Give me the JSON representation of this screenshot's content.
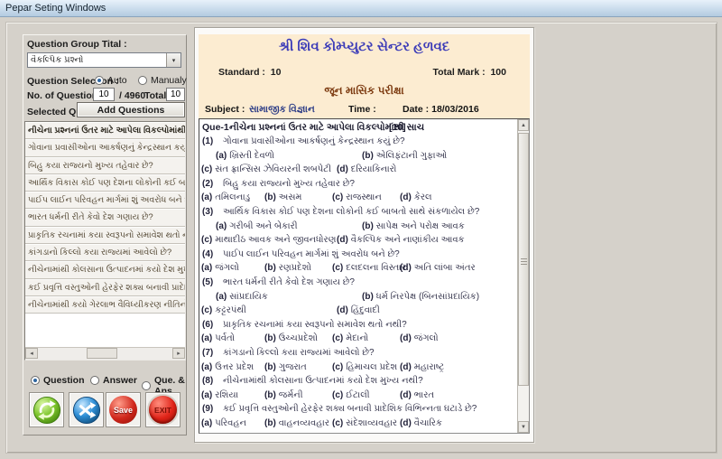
{
  "window": {
    "title": "Pepar Seting Windows"
  },
  "left_panel": {
    "group_title_label": "Question Group Tital :",
    "group_title_value": "વૈકલ્પિક પ્રશ્નો",
    "question_selection_label": "Question Selection :",
    "auto_label": "Auto",
    "manually_label": "Manualy",
    "no_of_questions_label": "No. of Questions :",
    "no_of_questions_value": "10",
    "of_total_label": "/ 4960",
    "total_label": "Total",
    "total_value": "10",
    "selected_questions_label": "Selected Questions :",
    "add_questions_button": "Add Questions",
    "list_rows": [
      "નીચેના પ્રશ્નનાં ઉતર માટે આપેલા વિકલ્પોમાંથી સાચ",
      "ગોવાના પ્રવાસીઓના આકર્ષણનું કેન્દ્રસ્થાન કયું છે?",
      "બિહુ કયા રાજ્યનો મુખ્ય તહેવાર છે?",
      "આર્થિક વિકાસ કોઈ પણ દેશના લોકોની કઈ બાબતો સાથે સં",
      "પાઈપ લાઈન પરિવહન માર્ગમાં શું અવરોધ બને છે?",
      "ભારત ધર્મની રીતે કેવો દેશ ગણાય છે?",
      "પ્રાકૃતિક રચનામાં કયા સ્વરૂપનો સમાવેશ થતો નથી?",
      "કાંગડાનો કિલ્લો કયા રાજ્યમાં આવેલો છે?",
      "નીચેનામાંથી કોલસાના ઉત્પાદનમાં કયો દેશ મુખ્ય નથી?",
      "કઈ પ્રવૃત્તિ વસ્તુઓની હેરફેર શક્ય બનાવી પ્રાદેશિક વિભિન્ન",
      "નીચેનામાંથી કયો ગેરલાભ વૈવિધ્યીકરણ નીતિનો નથી?"
    ],
    "output_options": [
      "Question",
      "Answer",
      "Que. & Ans."
    ],
    "output_selected": "Question",
    "save_button_label": "Save",
    "exit_button_label": "EXIT"
  },
  "paper": {
    "center_name": "શ્રી શિવ કોમ્પ્યુટર સેન્ટર હળવદ",
    "standard_label": "Standard :",
    "standard_value": "10",
    "total_mark_label": "Total Mark :",
    "total_mark_value": "100",
    "exam_name": "જૂન માસિક પરીક્ષા",
    "subject_label": "Subject :",
    "subject_value": "સામાજીક વિજ્ઞાન",
    "time_label": "Time :",
    "date_label": "Date :",
    "date_value": "18/03/2016",
    "question_header": {
      "no": "Que-1",
      "text": "નીચેના પ્રશ્નનાં ઉતર માટે આપેલા વિકલ્પોમાંથી સાચ",
      "marks": "[10]"
    },
    "option_labels": [
      "(a)",
      "(b)",
      "(c)",
      "(d)"
    ],
    "questions": [
      {
        "no": "(1)",
        "text": "ગોવાના પ્રવાસીઓના આકર્ષણનું કેન્દ્રસ્થાન કયું છે?",
        "layout": "two",
        "options": [
          "ખ્રિસ્તી દેવળો",
          "એલિફંટાની ગુફાઓ",
          "સંત ફ્રાન્સિસ ઝેવિયરની શબપેટી",
          "દરિયાકિનારો"
        ]
      },
      {
        "no": "(2)",
        "text": "બિહુ કયા રાજ્યનો મુખ્ય તહેવાર છે?",
        "layout": "four",
        "options": [
          "તમિલનાડુ",
          "અસમ",
          "રાજસ્થાન",
          "કેરલ"
        ]
      },
      {
        "no": "(3)",
        "text": "આર્થિક વિકાસ કોઈ પણ દેશના લોકોની કઈ બાબતો સાથે સંકળાયેલ છે?",
        "layout": "two",
        "options": [
          "ગરીબી અને બેકારી",
          "સાપેક્ષ અને પરોક્ષ આવક",
          "માથાદીઠ આવક અને જીવનધોરણ",
          "વૈકલ્પિક અને નાણાંકીય આવક"
        ]
      },
      {
        "no": "(4)",
        "text": "પાઈપ લાઈન પરિવહન માર્ગમાં શું અવરોધ બને છે?",
        "layout": "four",
        "options": [
          "જંગલો",
          "રણપ્રદેશો",
          "દલદલના વિસ્તાર",
          "અતિ લાંબા અંતર"
        ]
      },
      {
        "no": "(5)",
        "text": "ભારત ધર્મની રીતે કેવો દેશ ગણાય છે?",
        "layout": "two",
        "options": [
          "સાંપ્રદાયિક",
          "ધર્મ નિરપેક્ષ (બિનસાંપ્રદાયિક)",
          "કટ્ટરપંથી",
          "હિંદુવાદી"
        ]
      },
      {
        "no": "(6)",
        "text": "પ્રાકૃતિક રચનામાં કયા સ્વરૂપનો સમાવેશ થતો નથી?",
        "layout": "four",
        "options": [
          "પર્વતો",
          "ઉચ્ચપ્રદેશો",
          "મેદાનો",
          "જંગલો"
        ]
      },
      {
        "no": "(7)",
        "text": "કાંગડાનો કિલ્લો કયા રાજ્યમાં આવેલો છે?",
        "layout": "four",
        "options": [
          "ઉત્તર પ્રદેશ",
          "ગુજરાત",
          "હિમાચલ પ્રદેશ",
          "મહારાષ્ટ્ર"
        ]
      },
      {
        "no": "(8)",
        "text": "નીચેનામાંથી કોલસાના ઉત્પાદનમાં કયો દેશ મુખ્ય નથી?",
        "layout": "four",
        "options": [
          "રશિયા",
          "જર્મની",
          "ઈટાલી",
          "ભારત"
        ]
      },
      {
        "no": "(9)",
        "text": "કઈ પ્રવૃત્તિ વસ્તુઓની હેરફેર શક્ય બનાવી પ્રાદેશિક વિભિન્નતા ઘટાડે છે?",
        "layout": "four",
        "options": [
          "પરિવહન",
          "વાહનવ્યવહાર",
          "સંદેશાવ્યવહાર",
          "વૈચારિક"
        ]
      }
    ]
  },
  "colors": {
    "window_bg": "#d5d1ca",
    "paper_header_bg": "#fcecd1",
    "title_blue": "#3c3cb8",
    "exam_maroon": "#7c3a10",
    "subject_navy": "#2c3c86",
    "save_red": "#d0271c",
    "refresh_green": "#7ec62e",
    "shuffle_blue": "#2f8fd6"
  }
}
